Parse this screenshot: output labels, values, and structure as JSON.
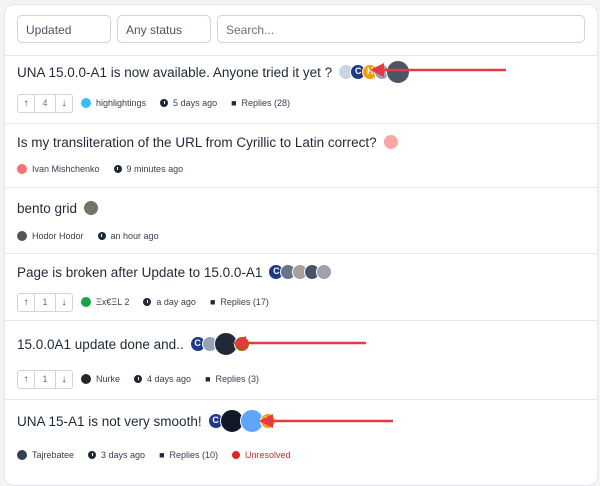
{
  "filters": {
    "sort": "Updated",
    "status": "Any status",
    "search_placeholder": "Search..."
  },
  "topics": [
    {
      "title": "UNA 15.0.0-A1 is now available. Anyone tried it yet ?",
      "votes": "4",
      "author": "highlightings",
      "time": "5 days ago",
      "replies": "Replies (28)"
    },
    {
      "title": "Is my transliteration of the URL from Cyrillic to Latin correct?",
      "author": "Ivan Mishchenko",
      "time": "9 minutes ago"
    },
    {
      "title": "bento grid",
      "author": "Hodor Hodor",
      "time": "an hour ago"
    },
    {
      "title": "Page is broken after Update to 15.0.0-A1",
      "votes": "1",
      "author": "Ξx€ΞL 2",
      "time": "a day ago",
      "replies": "Replies (17)"
    },
    {
      "title": "15.0.0A1 update done and..",
      "votes": "1",
      "author": "Nurke",
      "time": "4 days ago",
      "replies": "Replies (3)"
    },
    {
      "title": "UNA 15-A1 is not very smooth!",
      "author": "Tajrebatee",
      "time": "3 days ago",
      "replies": "Replies (10)",
      "status": "Unresolved"
    }
  ],
  "avatar_letters": {
    "c": "C",
    "h": "H"
  },
  "colors": {
    "accent_red": "#e53946",
    "unresolved": "#dc2626"
  },
  "icons": [
    "arrow-up-icon",
    "arrow-down-icon",
    "clock-icon",
    "replies-icon",
    "status-dot-icon"
  ]
}
